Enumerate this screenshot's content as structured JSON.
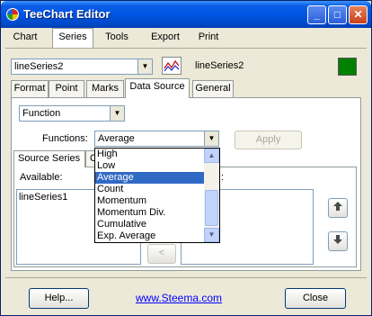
{
  "window": {
    "title": "TeeChart Editor",
    "minimize": "_",
    "maximize": "□",
    "close": "✕"
  },
  "menu_tabs": [
    "Chart",
    "Series",
    "Tools",
    "Export",
    "Print"
  ],
  "series_select": {
    "value": "lineSeries2"
  },
  "series_name_label": "lineSeries2",
  "series_color": "#008000",
  "series_tabs": [
    "Format",
    "Point",
    "Marks",
    "Data Source",
    "General"
  ],
  "data_source": {
    "type_select": "Function",
    "functions_label": "Functions:",
    "functions_value": "Average",
    "apply_button": "Apply",
    "sub_tabs": [
      "Source Series",
      "O"
    ],
    "available_label": "Available:",
    "selected_label_tail": ":",
    "available_items": [
      "lineSeries1"
    ],
    "move_left_button": "<",
    "move_up_icon": "🡅",
    "move_down_icon": "🡇"
  },
  "functions_dropdown": {
    "items": [
      "High",
      "Low",
      "Average",
      "Count",
      "Momentum",
      "Momentum Div.",
      "Cumulative",
      "Exp. Average"
    ],
    "selected": "Average"
  },
  "footer": {
    "help_button": "Help...",
    "link": "www.Steema.com",
    "close_button": "Close"
  }
}
